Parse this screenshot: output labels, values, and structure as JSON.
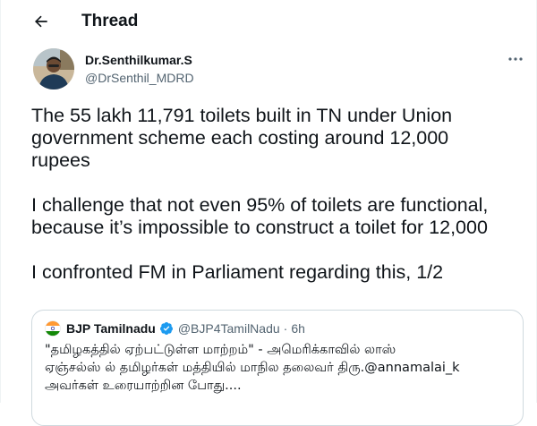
{
  "header": {
    "title": "Thread"
  },
  "tweet": {
    "author_name": "Dr.Senthilkumar.S",
    "author_handle": "@DrSenthil_MDRD",
    "paragraphs": [
      "The 55 lakh 11,791 toilets built in TN under Union\ngovernment scheme each costing around 12,000\nrupees",
      "I challenge that not even 95% of toilets are functional,\nbecause it’s impossible to construct a toilet for 12,000",
      "I confronted FM in Parliament regarding this, 1/2"
    ]
  },
  "quote": {
    "name": "BJP Tamilnadu",
    "handle": "@BJP4TamilNadu",
    "separator": "·",
    "time": "6h",
    "lines": [
      "\"தமிழகத்தில் ஏற்பட்டுள்ள மாற்றம்\" - அமெரிக்காவில் லாஸ்",
      "ஏஞ்சல்ஸ் ல் தமிழர்கள் மத்தியில் மாநில தலைவர் திரு.@annamalai_k",
      "அவர்கள் உரையாற்றின போது...."
    ]
  },
  "icons": {
    "back": "arrow-left-icon",
    "more": "more-horizontal-icon",
    "verified": "verified-badge-icon",
    "flag": "india-flag-icon"
  },
  "colors": {
    "text": "#0f1419",
    "secondary": "#536471",
    "border": "#cfd9de",
    "verified": "#1d9bf0"
  }
}
